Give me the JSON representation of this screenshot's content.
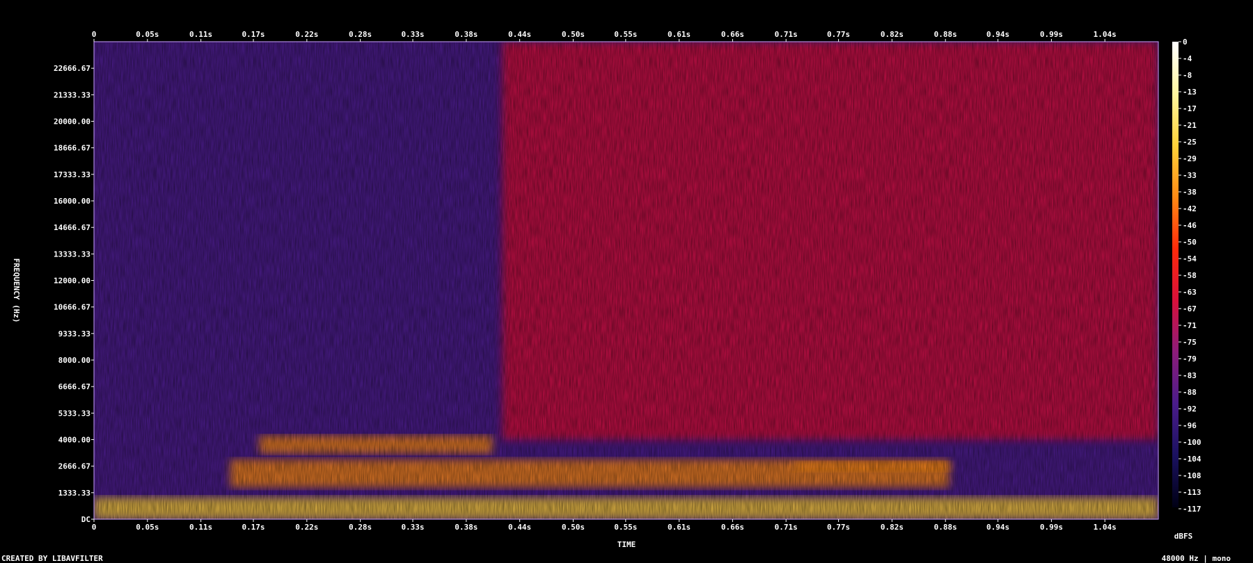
{
  "chart_data": {
    "type": "heatmap",
    "title": "",
    "xlabel": "TIME",
    "ylabel": "FREQUENCY (Hz)",
    "colorbar_label": "dBFS",
    "footer_left": "CREATED BY LIBAVFILTER",
    "footer_right": "48000 Hz | mono",
    "x_range_seconds": [
      0,
      1.095
    ],
    "y_range_hz": [
      0,
      24000
    ],
    "x_ticks": [
      {
        "label": "0",
        "value": 0
      },
      {
        "label": "0.05s",
        "value": 0.055
      },
      {
        "label": "0.11s",
        "value": 0.11
      },
      {
        "label": "0.17s",
        "value": 0.164
      },
      {
        "label": "0.22s",
        "value": 0.219
      },
      {
        "label": "0.28s",
        "value": 0.274
      },
      {
        "label": "0.33s",
        "value": 0.328
      },
      {
        "label": "0.38s",
        "value": 0.383
      },
      {
        "label": "0.44s",
        "value": 0.438
      },
      {
        "label": "0.50s",
        "value": 0.493
      },
      {
        "label": "0.55s",
        "value": 0.547
      },
      {
        "label": "0.61s",
        "value": 0.602
      },
      {
        "label": "0.66s",
        "value": 0.657
      },
      {
        "label": "0.71s",
        "value": 0.712
      },
      {
        "label": "0.77s",
        "value": 0.766
      },
      {
        "label": "0.82s",
        "value": 0.821
      },
      {
        "label": "0.88s",
        "value": 0.876
      },
      {
        "label": "0.94s",
        "value": 0.93
      },
      {
        "label": "0.99s",
        "value": 0.985
      },
      {
        "label": "1.04s",
        "value": 1.04
      }
    ],
    "y_ticks": [
      {
        "label": "DC",
        "value": 0
      },
      {
        "label": "1333.33",
        "value": 1333.33
      },
      {
        "label": "2666.67",
        "value": 2666.67
      },
      {
        "label": "4000.00",
        "value": 4000
      },
      {
        "label": "5333.33",
        "value": 5333.33
      },
      {
        "label": "6666.67",
        "value": 6666.67
      },
      {
        "label": "8000.00",
        "value": 8000
      },
      {
        "label": "9333.33",
        "value": 9333.33
      },
      {
        "label": "10666.67",
        "value": 10666.67
      },
      {
        "label": "12000.00",
        "value": 12000
      },
      {
        "label": "13333.33",
        "value": 13333.33
      },
      {
        "label": "14666.67",
        "value": 14666.67
      },
      {
        "label": "16000.00",
        "value": 16000
      },
      {
        "label": "17333.33",
        "value": 17333.33
      },
      {
        "label": "18666.67",
        "value": 18666.67
      },
      {
        "label": "20000.00",
        "value": 20000
      },
      {
        "label": "21333.33",
        "value": 21333.33
      },
      {
        "label": "22666.67",
        "value": 22666.67
      }
    ],
    "colorbar_ticks": [
      "0",
      "-4",
      "-8",
      "-13",
      "-17",
      "-21",
      "-25",
      "-29",
      "-33",
      "-38",
      "-42",
      "-46",
      "-50",
      "-54",
      "-58",
      "-63",
      "-67",
      "-71",
      "-75",
      "-79",
      "-83",
      "-88",
      "-92",
      "-96",
      "-100",
      "-104",
      "-108",
      "-113",
      "-117"
    ],
    "colorbar_range_db": [
      -120,
      0
    ],
    "colormap_stops": [
      "#ffffff",
      "#fff6a0",
      "#ffd23a",
      "#ff8a14",
      "#ff2a0a",
      "#d8103a",
      "#8c1c7a",
      "#4a1c8a",
      "#1a1160",
      "#000014"
    ],
    "spectral_features": [
      {
        "name": "low-frequency energy band",
        "t_start": 0.0,
        "t_end": 1.095,
        "f_low_hz": 0,
        "f_high_hz": 1100,
        "level_db": -28
      },
      {
        "name": "formant band 1",
        "t_start": 0.14,
        "t_end": 0.88,
        "f_low_hz": 1600,
        "f_high_hz": 3000,
        "level_db": -40
      },
      {
        "name": "formant band 2",
        "t_start": 0.17,
        "t_end": 0.41,
        "f_low_hz": 3300,
        "f_high_hz": 4200,
        "level_db": -42
      },
      {
        "name": "formant band 3",
        "t_start": 0.72,
        "t_end": 0.88,
        "f_low_hz": 2400,
        "f_high_hz": 2900,
        "level_db": -38
      },
      {
        "name": "broadband mid-high energy",
        "t_start": 0.42,
        "t_end": 1.095,
        "f_low_hz": 4000,
        "f_high_hz": 24000,
        "level_db": -62
      }
    ]
  }
}
